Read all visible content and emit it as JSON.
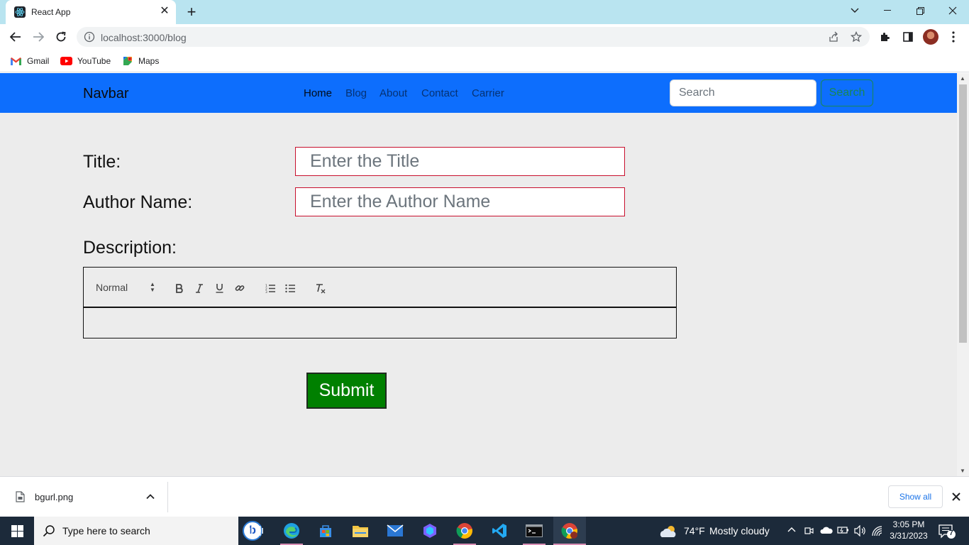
{
  "browser": {
    "tab_title": "React App",
    "url": "localhost:3000/blog",
    "bookmarks": [
      {
        "label": "Gmail"
      },
      {
        "label": "YouTube"
      },
      {
        "label": "Maps"
      }
    ]
  },
  "navbar": {
    "brand": "Navbar",
    "links": [
      {
        "label": "Home",
        "active": true
      },
      {
        "label": "Blog",
        "active": false
      },
      {
        "label": "About",
        "active": false
      },
      {
        "label": "Contact",
        "active": false
      },
      {
        "label": "Carrier",
        "active": false
      }
    ],
    "search_placeholder": "Search",
    "search_button": "Search"
  },
  "form": {
    "title_label": "Title:",
    "title_placeholder": "Enter the Title",
    "title_value": "",
    "author_label": "Author Name:",
    "author_placeholder": "Enter the Author Name",
    "author_value": "",
    "description_label": "Description:",
    "editor_format": "Normal",
    "toolbar_tools": [
      "bold-icon",
      "italic-icon",
      "underline-icon",
      "link-icon",
      "ordered-list-icon",
      "bullet-list-icon",
      "clear-format-icon"
    ],
    "submit_label": "Submit",
    "field_border_color": "#c8102e",
    "submit_color": "#008000"
  },
  "downloads": {
    "file_name": "bgurl.png",
    "show_all": "Show all"
  },
  "taskbar": {
    "search_placeholder": "Type here to search",
    "weather_temp": "74°F",
    "weather_desc": "Mostly cloudy",
    "time": "3:05 PM",
    "date": "3/31/2023",
    "notification_count": "7"
  },
  "colors": {
    "navbar_bg": "#0d6efd",
    "page_bg": "#ececec",
    "tabstrip_bg": "#b9e4f0",
    "taskbar_bg": "#1c2a3a"
  }
}
